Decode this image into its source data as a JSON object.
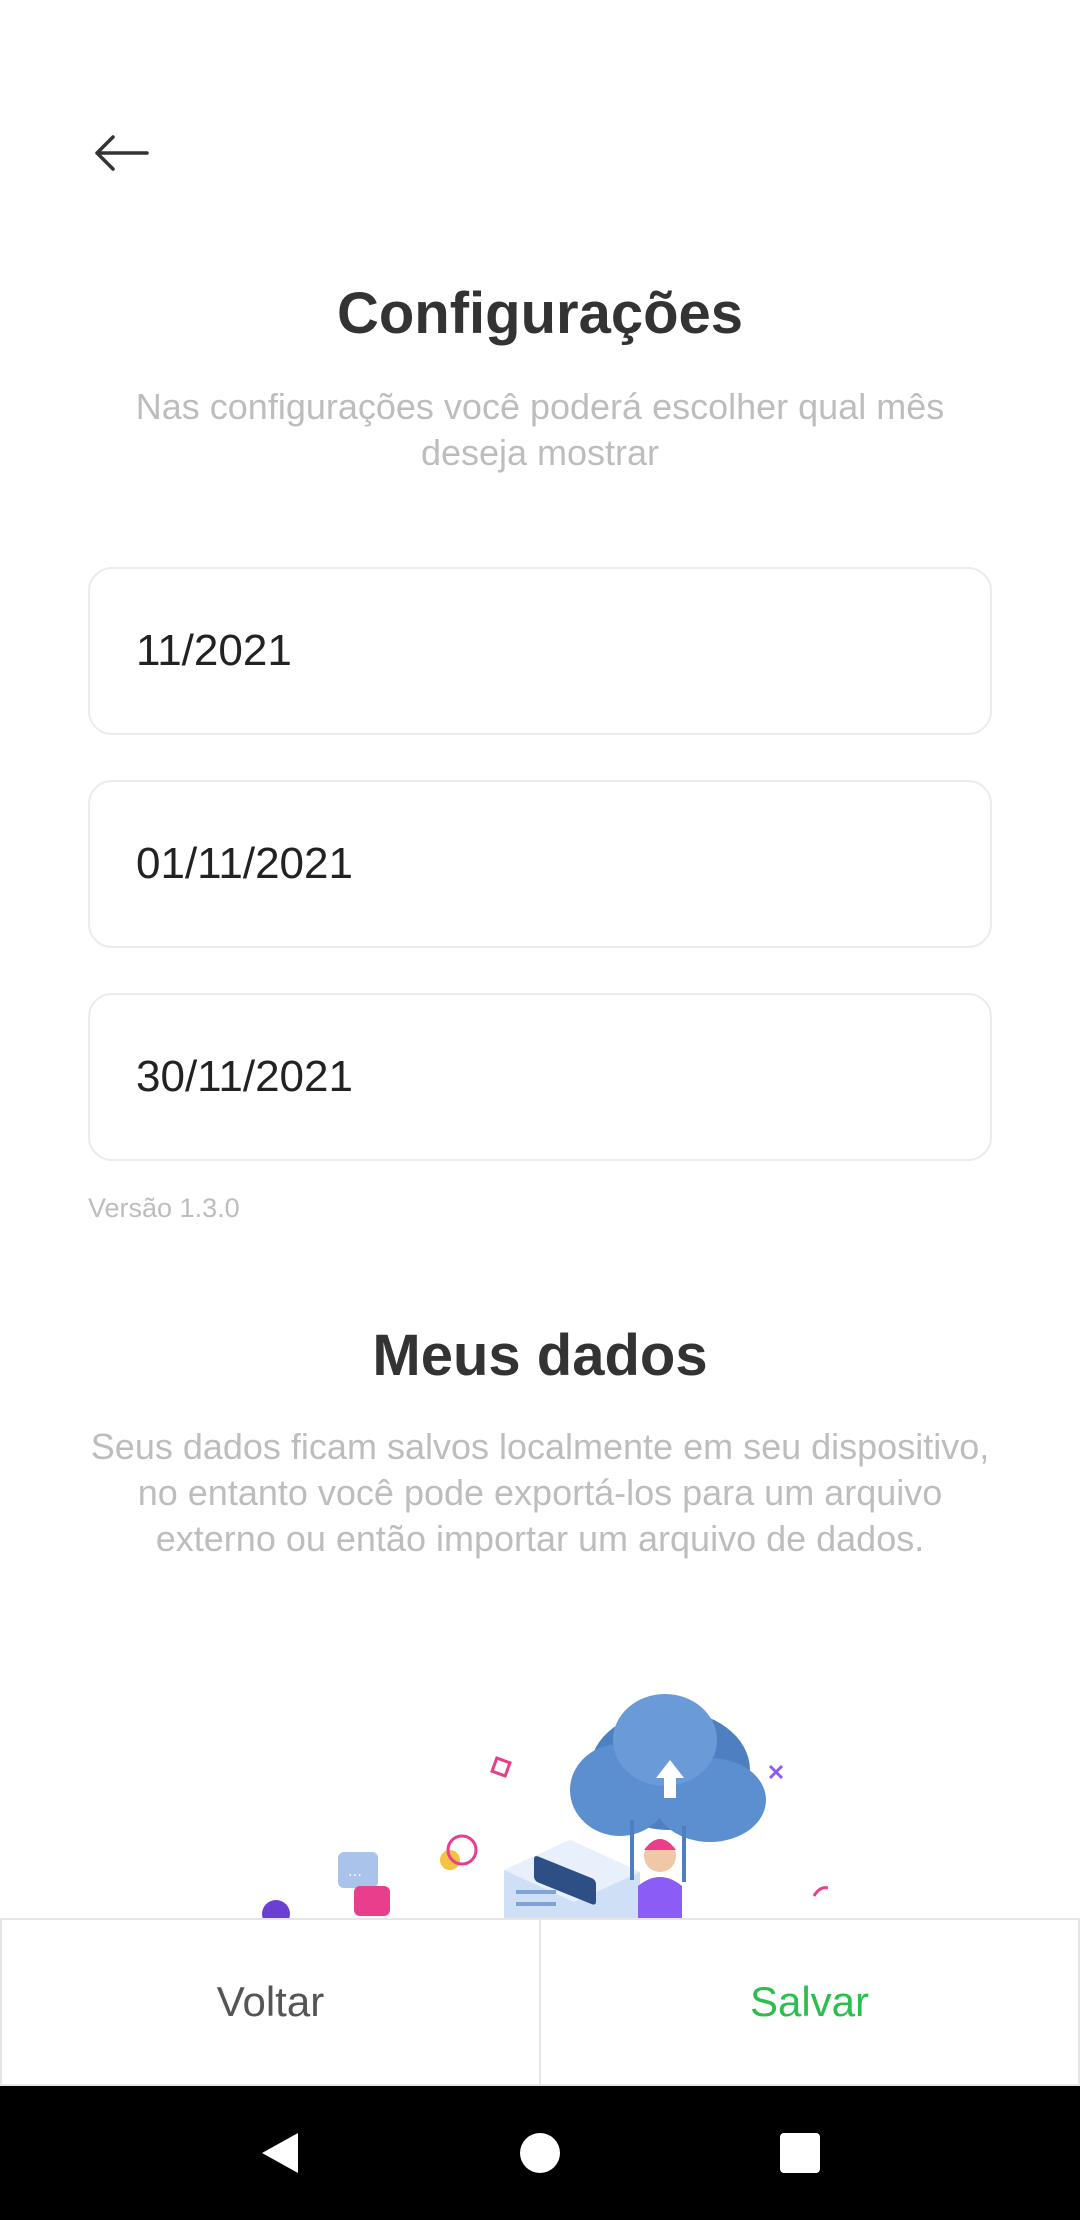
{
  "header": {
    "back_icon": "arrow-left-icon"
  },
  "settings": {
    "title": "Configurações",
    "subtitle": "Nas configurações você poderá escolher qual mês deseja mostrar",
    "month_value": "11/2021",
    "start_date_value": "01/11/2021",
    "end_date_value": "30/11/2021",
    "version": "Versão 1.3.0"
  },
  "my_data": {
    "title": "Meus dados",
    "description": "Seus dados ficam salvos localmente em seu dispositivo, no entanto você pode exportá-los para um arquivo externo ou então importar um arquivo de dados.",
    "illustration_icon": "cloud-server-illustration"
  },
  "footer": {
    "back_label": "Voltar",
    "save_label": "Salvar"
  },
  "colors": {
    "save_accent": "#2ebd4e",
    "title": "#333333",
    "muted": "#bdbdbd",
    "cloud": "#5b8fd0"
  },
  "system_nav": {
    "back_icon": "nav-back-icon",
    "home_icon": "nav-home-icon",
    "recents_icon": "nav-recents-icon"
  }
}
